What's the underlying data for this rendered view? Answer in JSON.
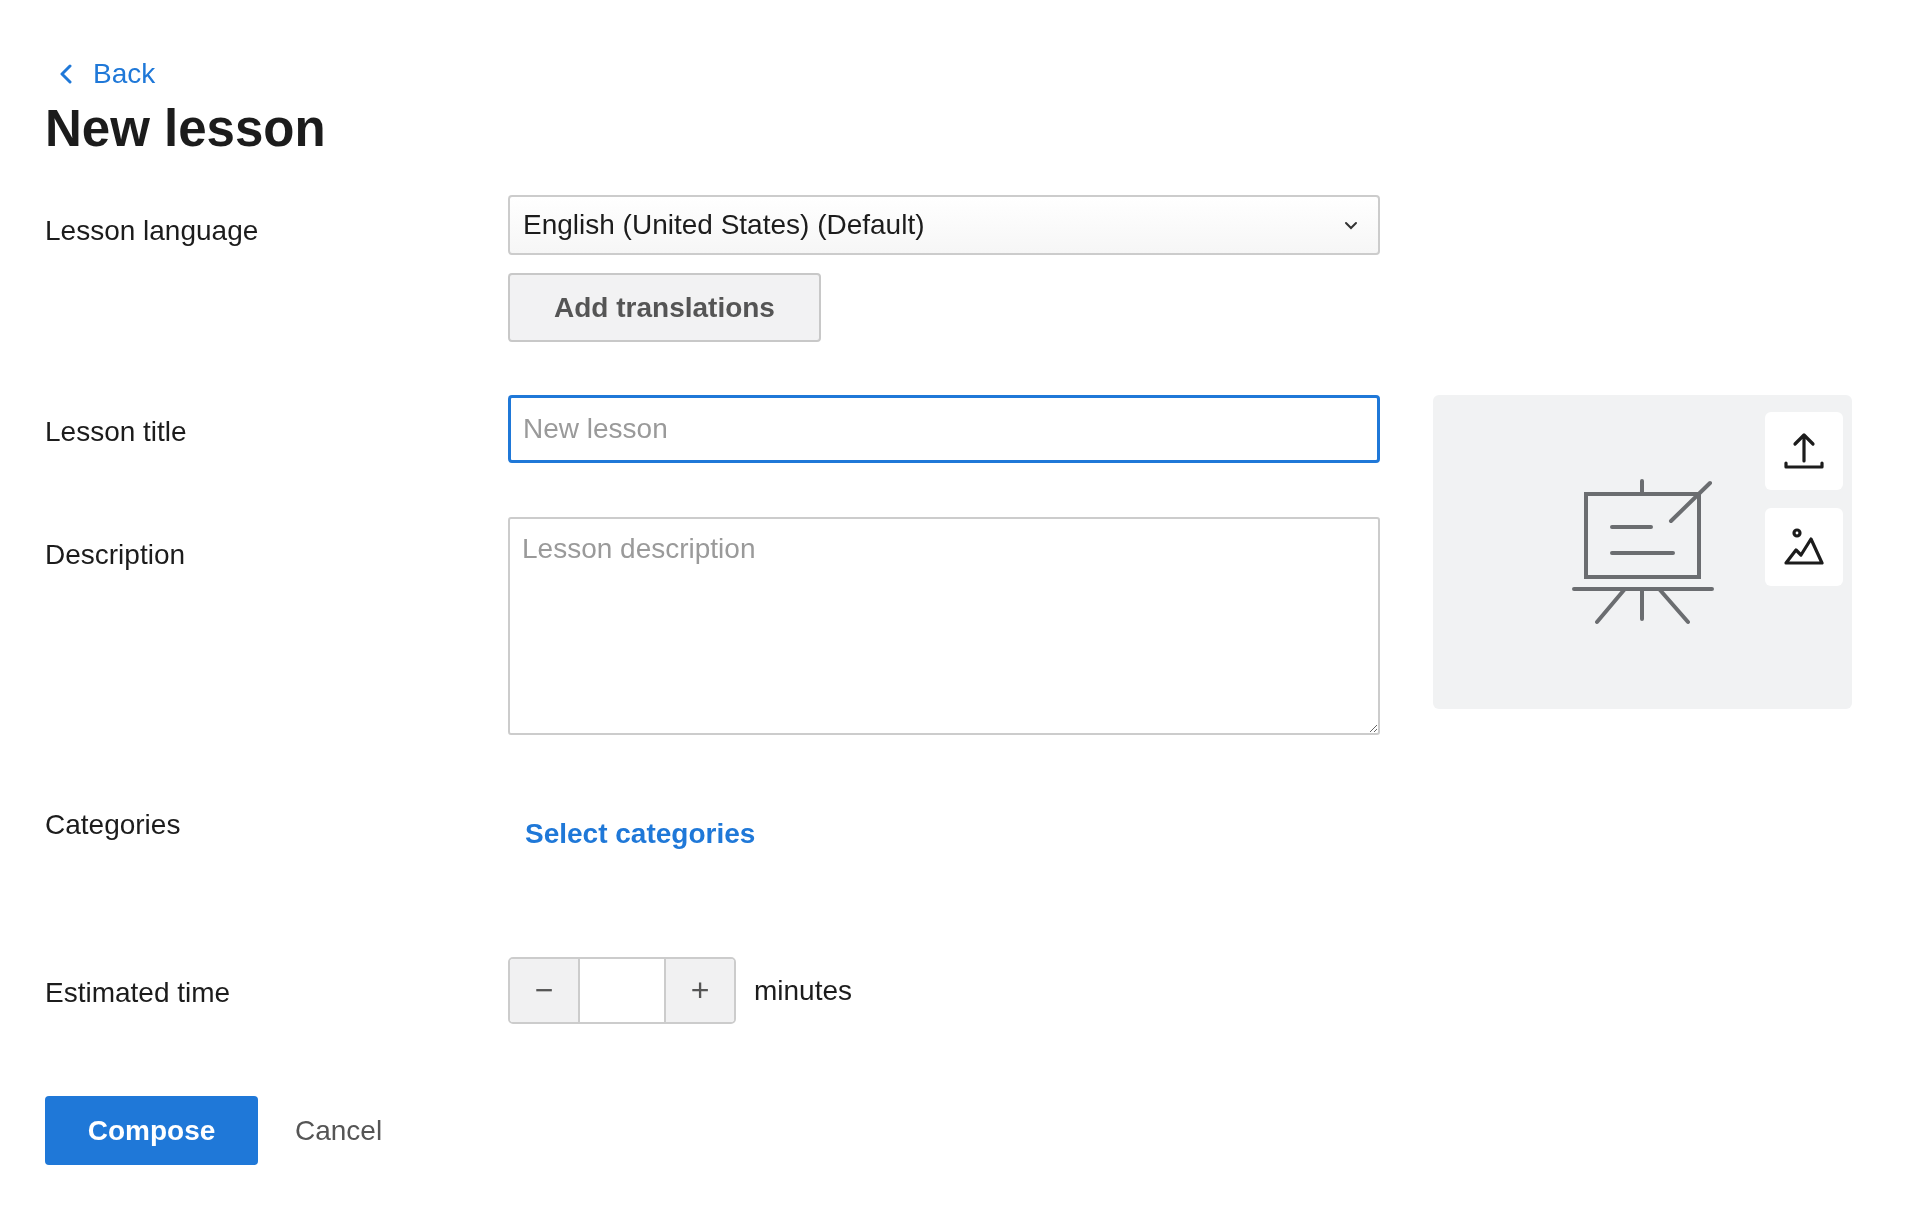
{
  "back_link": {
    "label": "Back"
  },
  "page_title": "New lesson",
  "fields": [
    {
      "kind": "select",
      "label": "Lesson language",
      "value": "English (United States) (Default)",
      "button": "Add translations"
    },
    {
      "kind": "text",
      "label": "Lesson title",
      "placeholder": "New lesson",
      "focused": true
    },
    {
      "kind": "textarea",
      "label": "Description",
      "placeholder": "Lesson description"
    },
    {
      "kind": "link",
      "label": "Categories",
      "link": "Select categories"
    },
    {
      "kind": "stepper",
      "label": "Estimated time",
      "decrement": "−",
      "increment": "+",
      "unit": "minutes"
    }
  ],
  "actions": [
    {
      "label": "Compose",
      "kind": "primary"
    },
    {
      "label": "Cancel",
      "kind": "secondary"
    }
  ]
}
